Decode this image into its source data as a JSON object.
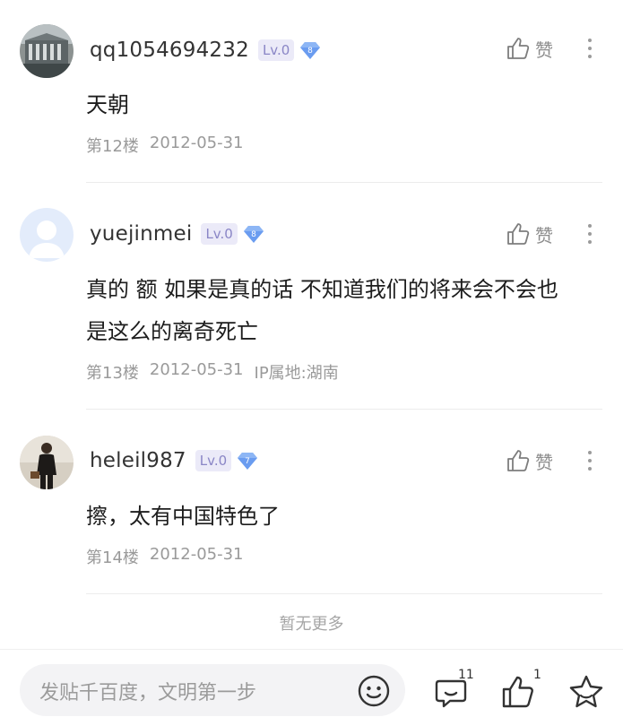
{
  "replies": [
    {
      "username": "qq1054694232",
      "level": "Lv.0",
      "vip": "8",
      "content_lines": [
        "天朝"
      ],
      "floor": "第12楼",
      "date": "2012-05-31",
      "ip": "",
      "like_label": "赞",
      "avatar_icon": "building-photo-avatar"
    },
    {
      "username": "yuejinmei",
      "level": "Lv.0",
      "vip": "8",
      "content_lines": [
        "真的 额 如果是真的话 不知道我们的将来会不会也",
        "是这么的离奇死亡"
      ],
      "floor": "第13楼",
      "date": "2012-05-31",
      "ip": "IP属地:湖南",
      "like_label": "赞",
      "avatar_icon": "default-user-avatar"
    },
    {
      "username": "heleil987",
      "level": "Lv.0",
      "vip": "7",
      "content_lines": [
        "擦，太有中国特色了"
      ],
      "floor": "第14楼",
      "date": "2012-05-31",
      "ip": "",
      "like_label": "赞",
      "avatar_icon": "person-photo-avatar"
    }
  ],
  "footer": {
    "no_more": "暂无更多"
  },
  "bottom_bar": {
    "placeholder": "发贴千百度，文明第一步",
    "comment_count": "11",
    "like_count": "1",
    "icons": [
      "emoji-icon",
      "comment-icon",
      "thumb-up-icon",
      "star-icon"
    ]
  },
  "colors": {
    "level_badge_bg": "#ebeaf8",
    "level_badge_text": "#8a86c6",
    "vip_gem": "#6a9cf0",
    "meta_text": "#9a9a9a"
  }
}
